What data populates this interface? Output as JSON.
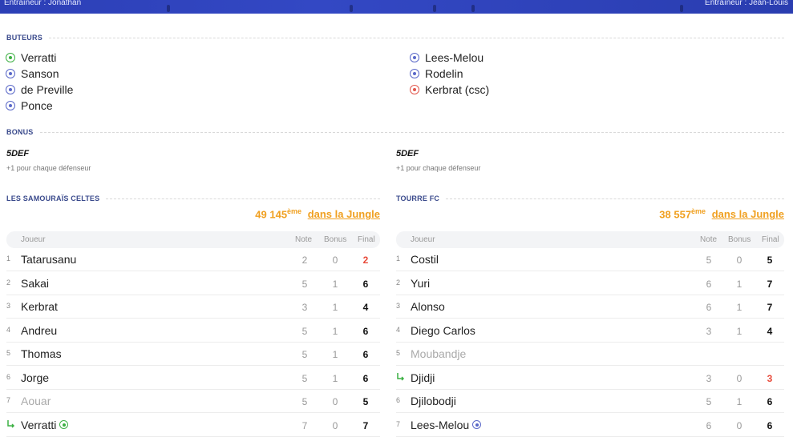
{
  "header": {
    "left_coach": "Entraîneur : Jonathan",
    "right_coach": "Entraîneur : Jean-Louis"
  },
  "sections": {
    "scorers_title": "BUTEURS",
    "bonus_title": "BONUS"
  },
  "scorers": {
    "left": [
      {
        "name": "Verratti",
        "ball": "green"
      },
      {
        "name": "Sanson",
        "ball": "blue"
      },
      {
        "name": "de Preville",
        "ball": "blue"
      },
      {
        "name": "Ponce",
        "ball": "blue"
      }
    ],
    "right": [
      {
        "name": "Lees-Melou",
        "ball": "blue"
      },
      {
        "name": "Rodelin",
        "ball": "blue"
      },
      {
        "name": "Kerbrat (csc)",
        "ball": "red"
      }
    ]
  },
  "bonus": {
    "left": {
      "name": "5DEF",
      "desc": "+1 pour chaque défenseur"
    },
    "right": {
      "name": "5DEF",
      "desc": "+1 pour chaque défenseur"
    }
  },
  "teams": {
    "left": {
      "name": "LES SAMOURAÏS CELTES",
      "rank_number": "49 145",
      "rank_suffix": "ème",
      "rank_link": "dans la Jungle"
    },
    "right": {
      "name": "TOURRE FC",
      "rank_number": "38 557",
      "rank_suffix": "ème",
      "rank_link": "dans la Jungle"
    }
  },
  "table_headers": {
    "player": "Joueur",
    "note": "Note",
    "bonus": "Bonus",
    "final": "Final"
  },
  "rows": {
    "left": [
      {
        "num": "1",
        "name": "Tatarusanu",
        "note": "2",
        "bonus": "0",
        "final": "2",
        "final_red": true
      },
      {
        "num": "2",
        "name": "Sakai",
        "note": "5",
        "bonus": "1",
        "final": "6"
      },
      {
        "num": "3",
        "name": "Kerbrat",
        "note": "3",
        "bonus": "1",
        "final": "4"
      },
      {
        "num": "4",
        "name": "Andreu",
        "note": "5",
        "bonus": "1",
        "final": "6"
      },
      {
        "num": "5",
        "name": "Thomas",
        "note": "5",
        "bonus": "1",
        "final": "6"
      },
      {
        "num": "6",
        "name": "Jorge",
        "note": "5",
        "bonus": "1",
        "final": "6"
      },
      {
        "num": "7",
        "name": "Aouar",
        "note": "5",
        "bonus": "0",
        "final": "5",
        "muted": true
      },
      {
        "num": "",
        "name": "Verratti",
        "note": "7",
        "bonus": "0",
        "final": "7",
        "sub": true,
        "ball": "green"
      }
    ],
    "right": [
      {
        "num": "1",
        "name": "Costil",
        "note": "5",
        "bonus": "0",
        "final": "5"
      },
      {
        "num": "2",
        "name": "Yuri",
        "note": "6",
        "bonus": "1",
        "final": "7"
      },
      {
        "num": "3",
        "name": "Alonso",
        "note": "6",
        "bonus": "1",
        "final": "7"
      },
      {
        "num": "4",
        "name": "Diego Carlos",
        "note": "3",
        "bonus": "1",
        "final": "4"
      },
      {
        "num": "5",
        "name": "Moubandje",
        "note": "",
        "bonus": "",
        "final": "",
        "muted": true
      },
      {
        "num": "",
        "name": "Djidji",
        "note": "3",
        "bonus": "0",
        "final": "3",
        "final_red": true,
        "sub": true
      },
      {
        "num": "6",
        "name": "Djilobodji",
        "note": "5",
        "bonus": "1",
        "final": "6"
      },
      {
        "num": "7",
        "name": "Lees-Melou",
        "note": "6",
        "bonus": "0",
        "final": "6",
        "ball": "blue"
      }
    ]
  }
}
